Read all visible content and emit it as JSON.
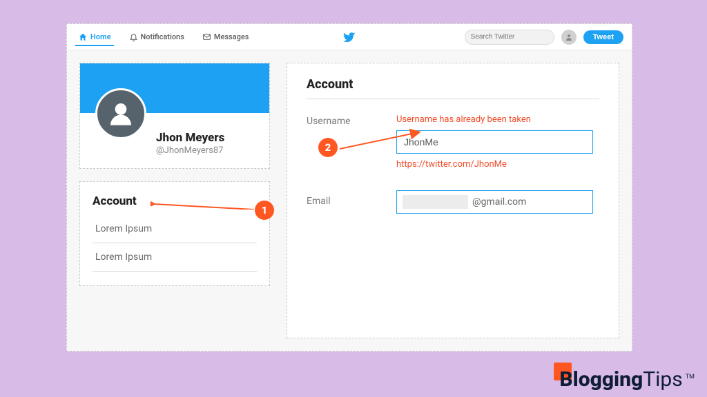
{
  "topbar": {
    "home": "Home",
    "notifications": "Notifications",
    "messages": "Messages",
    "search_placeholder": "Search Twitter",
    "tweet_label": "Tweet"
  },
  "profile": {
    "display_name": "Jhon Meyers",
    "handle": "@JhonMeyers87"
  },
  "sidebar_menu": {
    "title": "Account",
    "items": [
      "Lorem Ipsum",
      "Lorem Ipsum"
    ]
  },
  "settings": {
    "title": "Account",
    "username": {
      "label": "Username",
      "error": "Username has already been taken",
      "value": "JhonMe",
      "url": "https://twitter.com/JhonMe"
    },
    "email": {
      "label": "Email",
      "domain": "@gmail.com"
    }
  },
  "annotations": {
    "b1": "1",
    "b2": "2"
  },
  "watermark": {
    "part1": "Blogging",
    "part2": "Tips",
    "tm": "TM"
  }
}
